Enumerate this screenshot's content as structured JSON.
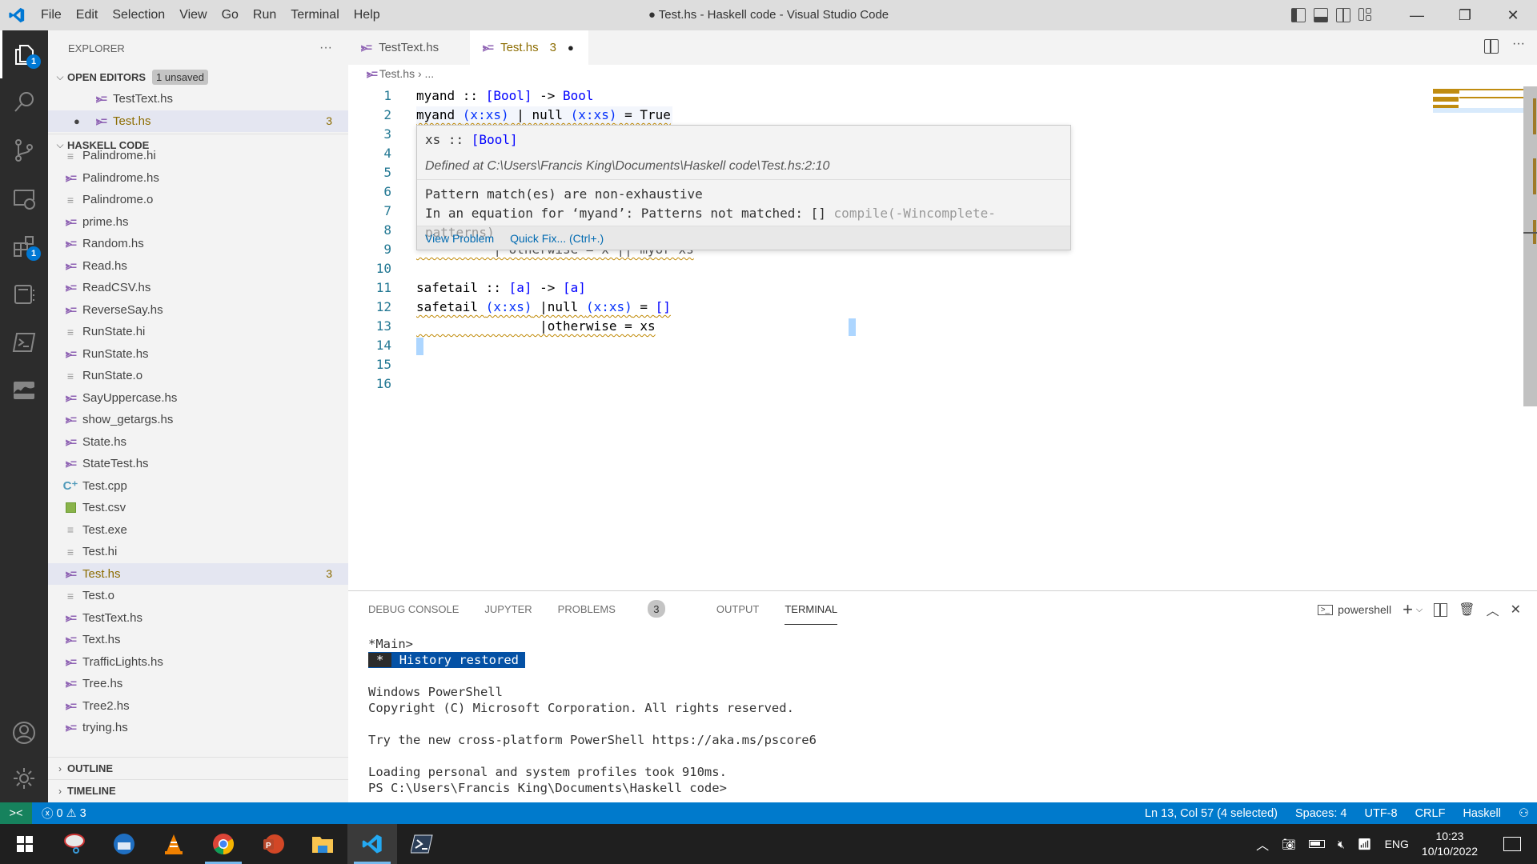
{
  "window": {
    "title": "● Test.hs - Haskell code - Visual Studio Code",
    "menu": [
      "File",
      "Edit",
      "Selection",
      "View",
      "Go",
      "Run",
      "Terminal",
      "Help"
    ]
  },
  "activity_bar": {
    "items": [
      {
        "icon": "explorer-icon",
        "badge": "1"
      },
      {
        "icon": "search-icon",
        "badge": null
      },
      {
        "icon": "source-control-icon",
        "badge": null
      },
      {
        "icon": "remote-explorer-icon",
        "badge": null
      },
      {
        "icon": "extensions-icon",
        "badge": "1"
      },
      {
        "icon": "notebook-icon",
        "badge": null
      },
      {
        "icon": "terminal-icon",
        "badge": null
      },
      {
        "icon": "ocaml-camel-icon",
        "badge": null
      }
    ]
  },
  "sidebar": {
    "title": "EXPLORER",
    "more": "···",
    "open_editors": {
      "label": "OPEN EDITORS",
      "badge": "1 unsaved",
      "items": [
        {
          "name": "TestText.hs",
          "modified": false,
          "count": ""
        },
        {
          "name": "Test.hs",
          "modified": true,
          "count": "3"
        }
      ]
    },
    "folder": {
      "label": "HASKELL CODE",
      "items": [
        {
          "name": "Palindrome.hi",
          "type": "text"
        },
        {
          "name": "Palindrome.hs",
          "type": "haskell"
        },
        {
          "name": "Palindrome.o",
          "type": "text"
        },
        {
          "name": "prime.hs",
          "type": "haskell"
        },
        {
          "name": "Random.hs",
          "type": "haskell"
        },
        {
          "name": "Read.hs",
          "type": "haskell"
        },
        {
          "name": "ReadCSV.hs",
          "type": "haskell"
        },
        {
          "name": "ReverseSay.hs",
          "type": "haskell"
        },
        {
          "name": "RunState.hi",
          "type": "text"
        },
        {
          "name": "RunState.hs",
          "type": "haskell"
        },
        {
          "name": "RunState.o",
          "type": "text"
        },
        {
          "name": "SayUppercase.hs",
          "type": "haskell"
        },
        {
          "name": "show_getargs.hs",
          "type": "haskell"
        },
        {
          "name": "State.hs",
          "type": "haskell"
        },
        {
          "name": "StateTest.hs",
          "type": "haskell"
        },
        {
          "name": "Test.cpp",
          "type": "cpp"
        },
        {
          "name": "Test.csv",
          "type": "csv"
        },
        {
          "name": "Test.exe",
          "type": "text"
        },
        {
          "name": "Test.hi",
          "type": "text"
        },
        {
          "name": "Test.hs",
          "type": "haskell",
          "selected": true,
          "count": "3"
        },
        {
          "name": "Test.o",
          "type": "text"
        },
        {
          "name": "TestText.hs",
          "type": "haskell"
        },
        {
          "name": "Text.hs",
          "type": "haskell"
        },
        {
          "name": "TrafficLights.hs",
          "type": "haskell"
        },
        {
          "name": "Tree.hs",
          "type": "haskell"
        },
        {
          "name": "Tree2.hs",
          "type": "haskell"
        },
        {
          "name": "trying.hs",
          "type": "haskell"
        }
      ]
    },
    "outline": "OUTLINE",
    "timeline": "TIMELINE"
  },
  "tabs": [
    {
      "label": "TestText.hs",
      "active": false
    },
    {
      "label": "Test.hs",
      "active": true,
      "count": "3",
      "dirty": "●"
    }
  ],
  "breadcrumb": {
    "file": "Test.hs",
    "sep": "›",
    "rest": "..."
  },
  "editor": {
    "line_numbers": [
      "1",
      "2",
      "3",
      "4",
      "5",
      "6",
      "7",
      "8",
      "9",
      "10",
      "11",
      "12",
      "13",
      "14",
      "15",
      "16"
    ],
    "lines": {
      "l1": {
        "a": "myand :: ",
        "b": "[Bool]",
        "c": " -> ",
        "d": "Bool"
      },
      "l2": {
        "a": "myand ",
        "b": "(x:xs)",
        "c": " | null ",
        "d": "(x:xs)",
        "e": " = True"
      },
      "l9_partial": "          | otherwise = x || myor xs",
      "l11": {
        "a": "safetail :: ",
        "b": "[a]",
        "c": " -> ",
        "d": "[a]"
      },
      "l12": {
        "a": "safetail ",
        "b": "(x:xs)",
        "c": " |null ",
        "d": "(x:xs)",
        "e": " = ",
        "f": "[]"
      },
      "l13": "                |otherwise = xs"
    }
  },
  "hover": {
    "type_sig_a": "xs :: ",
    "type_sig_b": "[Bool]",
    "defined_at": "Defined at C:\\Users\\Francis King\\Documents\\Haskell code\\Test.hs:2:10",
    "problem_line1": "Pattern match(es) are non-exhaustive",
    "problem_line2": "In an equation for ‘myand’: Patterns not matched: [] ",
    "problem_source": "compile(-Wincomplete-patterns)",
    "view_problem": "View Problem",
    "quick_fix": "Quick Fix... (Ctrl+.)"
  },
  "panel": {
    "tabs": [
      "DEBUG CONSOLE",
      "JUPYTER",
      "PROBLEMS",
      "OUTPUT",
      "TERMINAL"
    ],
    "problems_count": "3",
    "active_tab": "TERMINAL",
    "terminal_name": "powershell",
    "terminal": {
      "l1": "*Main>",
      "restored_star": "*",
      "restored_text": "History restored",
      "l3": "Windows PowerShell",
      "l4": "Copyright (C) Microsoft Corporation. All rights reserved.",
      "l5": "Try the new cross-platform PowerShell https://aka.ms/pscore6",
      "l6": "Loading personal and system profiles took 910ms.",
      "l7": "PS C:\\Users\\Francis King\\Documents\\Haskell code>"
    }
  },
  "status_bar": {
    "errors": "0",
    "warnings": "3",
    "position": "Ln 13, Col 57 (4 selected)",
    "spaces": "Spaces: 4",
    "encoding": "UTF-8",
    "eol": "CRLF",
    "language": "Haskell"
  },
  "taskbar": {
    "apps": [
      "start",
      "snipping-tool",
      "thunderbird",
      "vlc",
      "chrome",
      "powerpoint",
      "file-explorer",
      "vscode",
      "powershell"
    ],
    "language": "ENG",
    "time": "10:23",
    "date": "10/10/2022"
  },
  "colors": {
    "accent": "#007acc",
    "modified": "#8c6c00",
    "warning": "#bf8803",
    "haskell": "#8e62b3"
  }
}
